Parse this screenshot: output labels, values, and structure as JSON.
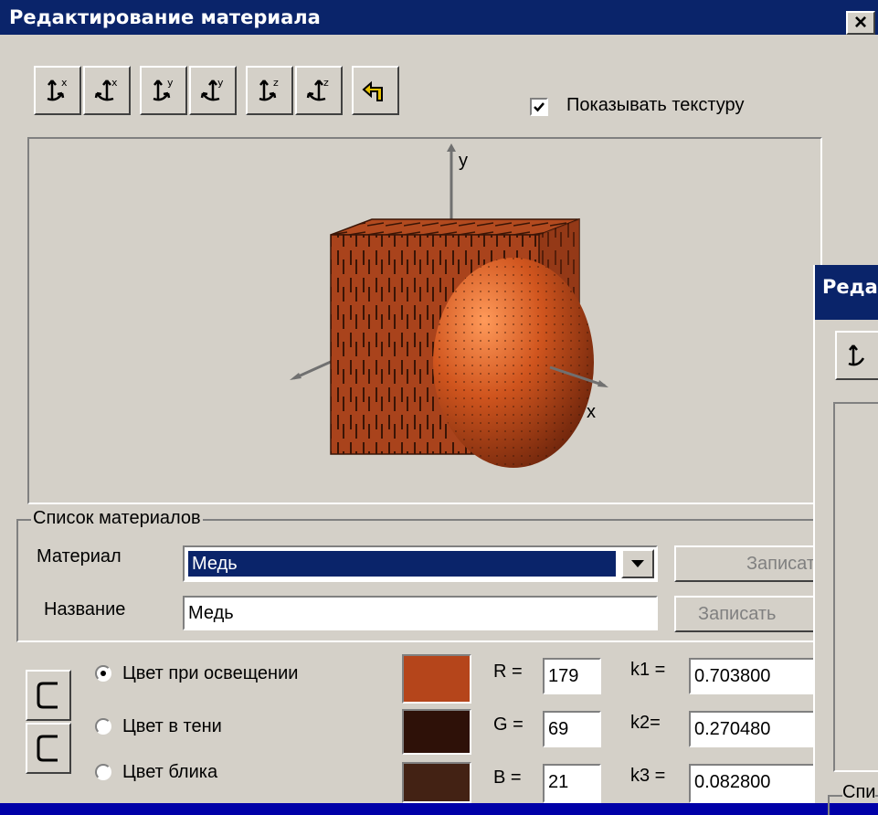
{
  "main": {
    "title": "Редактирование материала",
    "close_glyph": "×",
    "toolbar": [
      {
        "icon": "rotate-x-ccw-icon",
        "axis": "x"
      },
      {
        "icon": "rotate-x-cw-icon",
        "axis": "x"
      },
      {
        "icon": "rotate-y-ccw-icon",
        "axis": "y"
      },
      {
        "icon": "rotate-y-cw-icon",
        "axis": "y"
      },
      {
        "icon": "rotate-z-ccw-icon",
        "axis": "z"
      },
      {
        "icon": "rotate-z-cw-icon",
        "axis": "z"
      },
      {
        "icon": "undo-arrow-icon",
        "axis": ""
      }
    ],
    "show_texture": {
      "label": "Показывать текстуру",
      "checked": true
    },
    "preview": {
      "axis_y": "y",
      "axis_x_right": "x"
    },
    "materials_group": {
      "legend": "Список материалов",
      "material_label": "Материал",
      "material_value": "Медь",
      "name_label": "Название",
      "name_value": "Медь",
      "save_button": "Записат",
      "save_as_button": "Записать"
    },
    "colors": {
      "options": [
        {
          "label": "Цвет при освещении",
          "selected": true
        },
        {
          "label": "Цвет в тени",
          "selected": false
        },
        {
          "label": "Цвет блика",
          "selected": false
        }
      ],
      "swatches": [
        "#b5451b",
        "#2e1108",
        "#432214"
      ],
      "channels": [
        {
          "label": "R =",
          "value": "179"
        },
        {
          "label": "G =",
          "value": "69"
        },
        {
          "label": "B =",
          "value": "21"
        }
      ],
      "coeffs": [
        {
          "label": "k1 =",
          "value": "0.703800"
        },
        {
          "label": "k2=",
          "value": "0.270480"
        },
        {
          "label": "k3 =",
          "value": "0.082800"
        }
      ]
    }
  },
  "second": {
    "title": "Реда",
    "group_legend": "Спи"
  }
}
